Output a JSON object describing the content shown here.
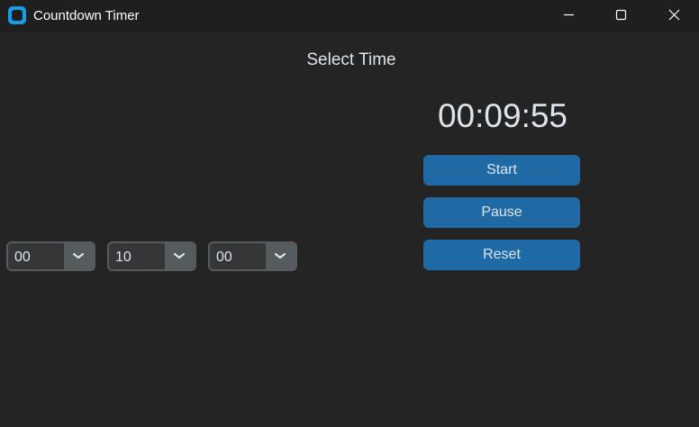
{
  "window": {
    "title": "Countdown Timer",
    "controls": {
      "minimize_icon": "minimize-icon",
      "maximize_icon": "maximize-icon",
      "close_icon": "close-icon"
    }
  },
  "main": {
    "select_label": "Select Time",
    "hours": {
      "value": "00",
      "icon": "chevron-down-icon"
    },
    "minutes": {
      "value": "10",
      "icon": "chevron-down-icon"
    },
    "seconds": {
      "value": "00",
      "icon": "chevron-down-icon"
    },
    "timer_display": "00:09:55",
    "buttons": {
      "start": "Start",
      "pause": "Pause",
      "reset": "Reset"
    }
  },
  "colors": {
    "background": "#242424",
    "titlebar": "#1f1f1f",
    "accent": "#1f6aa5",
    "combo_bg": "#343638",
    "combo_border": "#565b5e",
    "text": "#dce4ee"
  }
}
